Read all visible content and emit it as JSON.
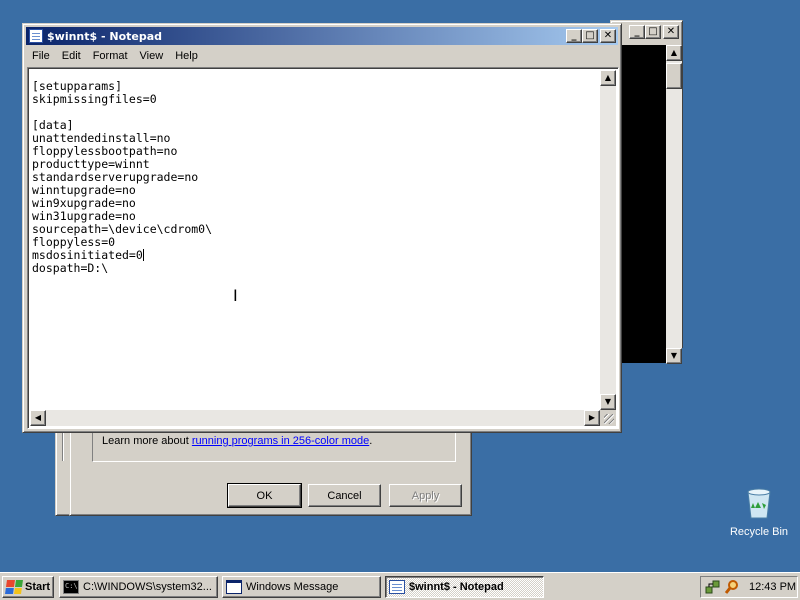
{
  "notepad": {
    "title": "$winnt$ - Notepad",
    "menu": [
      "File",
      "Edit",
      "Format",
      "View",
      "Help"
    ],
    "lines": [
      "[setupparams]",
      "skipmissingfiles=0",
      "",
      "[data]",
      "unattendedinstall=no",
      "floppylessbootpath=no",
      "producttype=winnt",
      "standardserverupgrade=no",
      "winntupgrade=no",
      "win9xupgrade=no",
      "win31upgrade=no",
      "sourcepath=\\device\\cdrom0\\",
      "floppyless=0",
      "msdosinitiated=0",
      "dospath=D:\\"
    ]
  },
  "dialog": {
    "learn_more_prefix": "Learn more about ",
    "learn_more_link": "running programs in 256-color mode",
    "learn_more_suffix": ".",
    "ok_label": "OK",
    "cancel_label": "Cancel",
    "apply_label": "Apply"
  },
  "desktop": {
    "recycle_bin_label": "Recycle Bin"
  },
  "taskbar": {
    "start_label": "Start",
    "tasks": [
      {
        "label": "C:\\WINDOWS\\system32..."
      },
      {
        "label": "Windows Message"
      },
      {
        "label": "$winnt$ - Notepad"
      }
    ],
    "clock": "12:43 PM"
  },
  "icons": {
    "titlebar": "notepad-icon",
    "start": "windows-logo-icon",
    "tray": [
      "network-icon",
      "search-magnifier-icon"
    ]
  }
}
